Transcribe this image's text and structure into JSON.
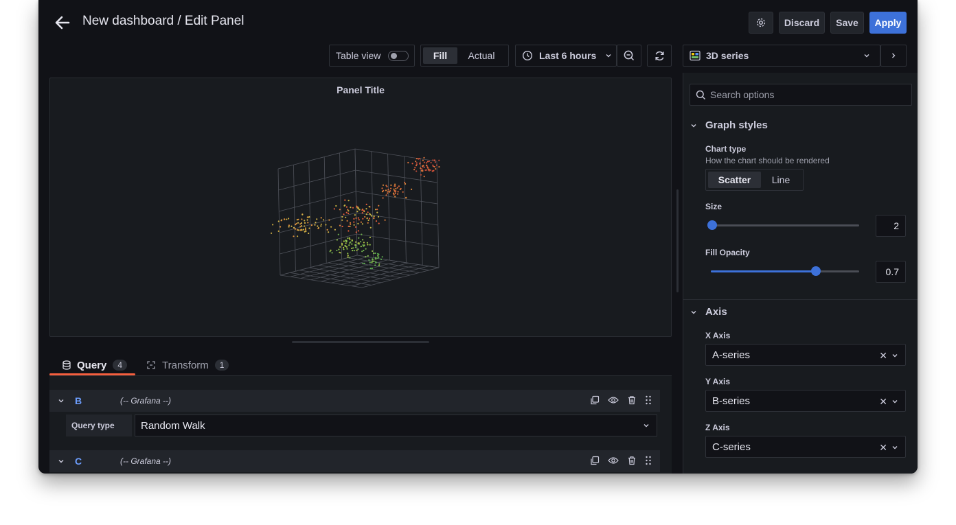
{
  "header": {
    "title": "New dashboard / Edit Panel",
    "discard_label": "Discard",
    "save_label": "Save",
    "apply_label": "Apply"
  },
  "toolbar": {
    "table_view_label": "Table view",
    "table_view_on": false,
    "fill_label": "Fill",
    "actual_label": "Actual",
    "time_range_label": "Last 6 hours",
    "visualization_label": "3D series"
  },
  "panel": {
    "title": "Panel Title"
  },
  "query_tabs": {
    "query_label": "Query",
    "query_count": "4",
    "transform_label": "Transform",
    "transform_count": "1"
  },
  "queries": [
    {
      "letter": "B",
      "datasource": "(-- Grafana --)",
      "query_type_label": "Query type",
      "query_type_value": "Random Walk"
    },
    {
      "letter": "C",
      "datasource": "(-- Grafana --)"
    }
  ],
  "options": {
    "search_placeholder": "Search options",
    "graph_styles_label": "Graph styles",
    "chart_type_label": "Chart type",
    "chart_type_desc": "How the chart should be rendered",
    "chart_type_options": [
      "Scatter",
      "Line"
    ],
    "chart_type_selected": "Scatter",
    "size_label": "Size",
    "size_value": "2",
    "size_fraction": 0.0,
    "fill_opacity_label": "Fill Opacity",
    "fill_opacity_value": "0.7",
    "fill_opacity_fraction": 0.7,
    "axis_label": "Axis",
    "x_axis_label": "X Axis",
    "x_axis_value": "A-series",
    "y_axis_label": "Y Axis",
    "y_axis_value": "B-series",
    "z_axis_label": "Z Axis",
    "z_axis_value": "C-series"
  },
  "colors": {
    "background": "#111217",
    "panel": "#181b1f",
    "accent": "#3d71d9",
    "tab_underline": "#f55f3e",
    "query_letter": "#6e9fff"
  }
}
